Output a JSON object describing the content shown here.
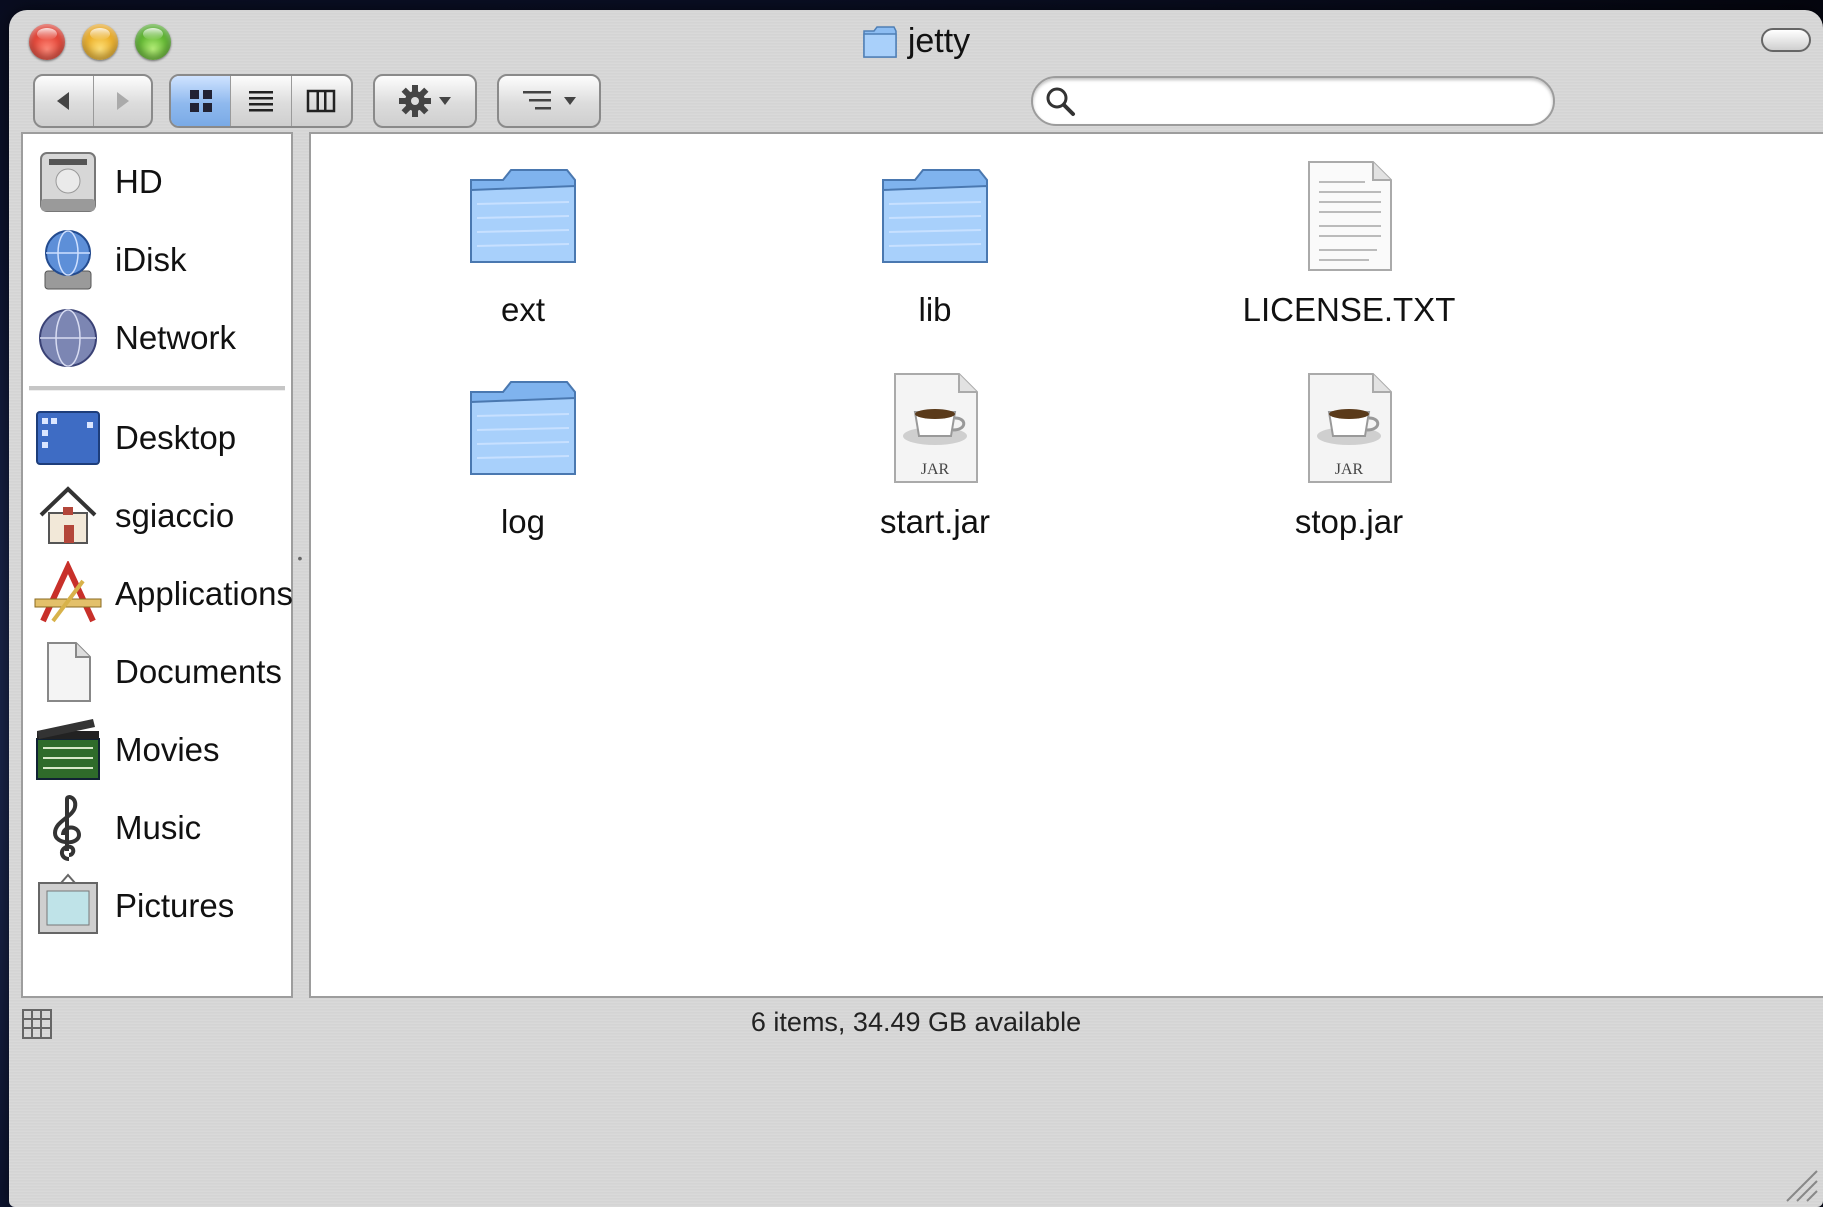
{
  "window": {
    "title": "jetty",
    "colors": {
      "selection": "#8fb9ee",
      "folder": "#7fb3ee"
    }
  },
  "toolbar": {
    "back_icon": "back-arrow-icon",
    "forward_icon": "forward-arrow-icon",
    "views": [
      "icon-view",
      "list-view",
      "column-view"
    ],
    "selected_view": "icon-view",
    "action_icon": "gear-icon",
    "arrange_icon": "arrange-icon",
    "search": {
      "value": "",
      "placeholder": ""
    }
  },
  "sidebar": {
    "devices": [
      {
        "label": "HD",
        "icon": "hard-drive-icon"
      },
      {
        "label": "iDisk",
        "icon": "idisk-icon"
      },
      {
        "label": "Network",
        "icon": "network-globe-icon"
      }
    ],
    "places": [
      {
        "label": "Desktop",
        "icon": "desktop-icon"
      },
      {
        "label": "sgiaccio",
        "icon": "home-icon"
      },
      {
        "label": "Applications",
        "icon": "applications-icon"
      },
      {
        "label": "Documents",
        "icon": "documents-icon"
      },
      {
        "label": "Movies",
        "icon": "movies-clapper-icon"
      },
      {
        "label": "Music",
        "icon": "music-clef-icon"
      },
      {
        "label": "Pictures",
        "icon": "pictures-frame-icon"
      }
    ]
  },
  "files": [
    {
      "name": "ext",
      "type": "folder"
    },
    {
      "name": "lib",
      "type": "folder"
    },
    {
      "name": "LICENSE.TXT",
      "type": "text"
    },
    {
      "name": "log",
      "type": "folder"
    },
    {
      "name": "start.jar",
      "type": "jar",
      "badge": "JAR"
    },
    {
      "name": "stop.jar",
      "type": "jar",
      "badge": "JAR"
    }
  ],
  "status": {
    "text": "6 items, 34.49 GB available"
  }
}
